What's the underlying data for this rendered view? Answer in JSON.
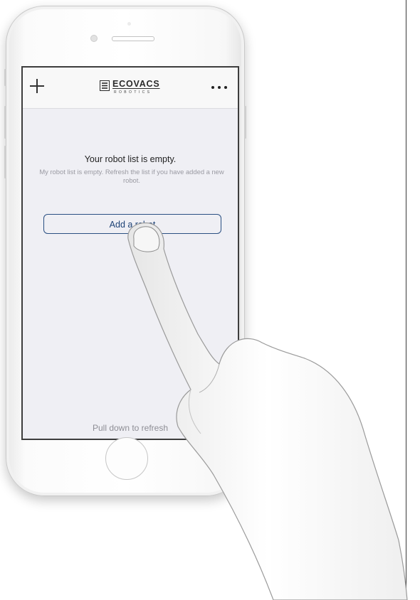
{
  "app": {
    "brand_name": "ECOVACS",
    "brand_subtitle": "ROBOTICS"
  },
  "nav": {
    "add_icon": "plus-icon",
    "more_icon": "ellipsis-icon"
  },
  "empty_state": {
    "title": "Your robot list is empty.",
    "description": "My robot list is empty. Refresh the list if you have added a new robot.",
    "button_label": "Add a robot"
  },
  "footer": {
    "hint": "Pull down to refresh"
  },
  "colors": {
    "accent": "#1d4275",
    "screen_bg": "#efeff4",
    "muted_text": "#9a9aa2"
  }
}
